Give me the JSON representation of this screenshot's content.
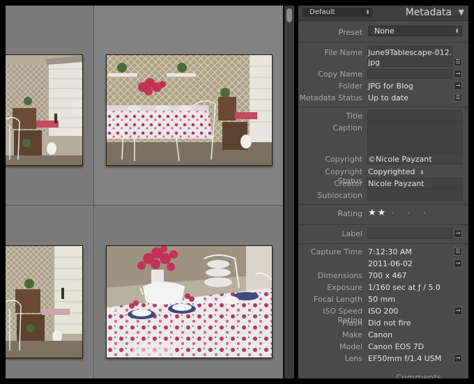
{
  "metadata_panel": {
    "header": {
      "preset_dropdown": "Default",
      "title": "Metadata"
    },
    "preset": {
      "label": "Preset",
      "value": "None"
    },
    "fields": {
      "file_name": {
        "label": "File Name",
        "value_line1": "June9Tablescape-012.",
        "value_line2": "jpg"
      },
      "copy_name": {
        "label": "Copy Name",
        "value": ""
      },
      "folder": {
        "label": "Folder",
        "value": "JPG for Blog"
      },
      "metadata_status": {
        "label": "Metadata Status",
        "value": "Up to date"
      },
      "title": {
        "label": "Title",
        "value": ""
      },
      "caption": {
        "label": "Caption",
        "value": ""
      },
      "copyright": {
        "label": "Copyright",
        "value": "©Nicole Payzant"
      },
      "copyright_status": {
        "label": "Copyright Status",
        "value": "Copyrighted"
      },
      "creator": {
        "label": "Creator",
        "value": "Nicole Payzant"
      },
      "sublocation": {
        "label": "Sublocation",
        "value": ""
      },
      "rating": {
        "label": "Rating",
        "stars": 2,
        "max": 5,
        "filled": "★★",
        "empty": "· · ·"
      },
      "label": {
        "label": "Label",
        "value": ""
      },
      "capture_time": {
        "label": "Capture Time",
        "time": "7:12:30 AM",
        "date": "2011-06-02"
      },
      "dimensions": {
        "label": "Dimensions",
        "value": "700 x 467"
      },
      "exposure": {
        "label": "Exposure",
        "value": "1/160 sec at ƒ / 5.0"
      },
      "focal_length": {
        "label": "Focal Length",
        "value": "50 mm"
      },
      "iso": {
        "label": "ISO Speed Rating",
        "value": "ISO 200"
      },
      "flash": {
        "label": "Flash",
        "value": "Did not fire"
      },
      "make": {
        "label": "Make",
        "value": "Canon"
      },
      "model": {
        "label": "Model",
        "value": "Canon EOS 7D"
      },
      "lens": {
        "label": "Lens",
        "value": "EF50mm f/1.4 USM"
      }
    },
    "next_panel": "Comments"
  },
  "colors": {
    "grid_bg": "#6c6c6c",
    "panel_bg": "#4a4a4a",
    "label_text": "#a8a8a8",
    "value_text": "#e6e6e6"
  }
}
